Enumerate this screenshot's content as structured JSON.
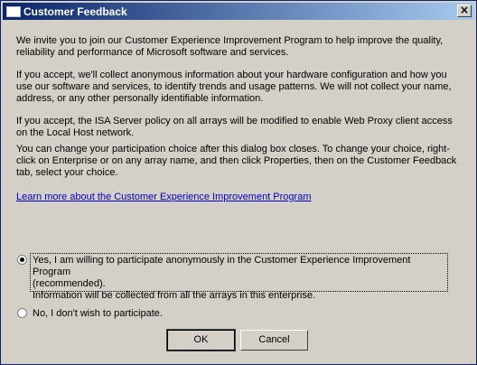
{
  "window": {
    "title": "Customer Feedback"
  },
  "body": {
    "paragraphs": [
      "We invite you to join our Customer Experience Improvement Program to help improve the quality, reliability and performance of Microsoft software and services.",
      "If you accept, we'll collect anonymous information about your hardware configuration and how you use our software and services, to identify trends and usage patterns. We will not collect your name, address, or any other personally identifiable information.",
      "If you accept, the ISA Server policy on all arrays will be modified to enable Web Proxy client access on the Local Host network.",
      "You can change your participation choice after this dialog box closes. To change your choice, right-click on Enterprise or on any array name, and then click Properties, then on the Customer Feedback tab, select your choice."
    ],
    "learn_more_link": "Learn more about the Customer Experience Improvement Program"
  },
  "options": {
    "yes_label_line1": "Yes, I am willing to participate anonymously in the Customer Experience Improvement Program",
    "yes_label_line2": "(recommended).",
    "yes_label_line3": "Information will be collected from all the arrays in this enterprise.",
    "no_label": "No, I don't wish to participate.",
    "selected": "yes"
  },
  "buttons": {
    "ok": "OK",
    "cancel": "Cancel"
  }
}
